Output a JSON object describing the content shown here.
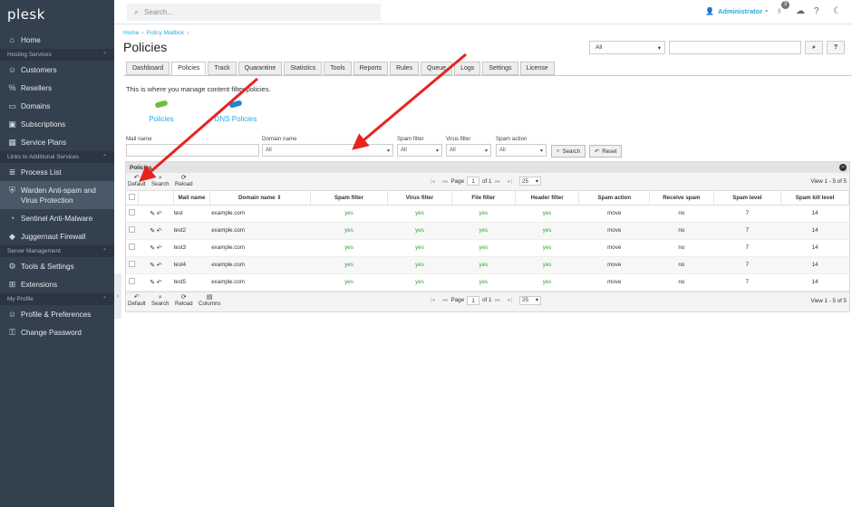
{
  "sidebar": {
    "logo": "plesk",
    "items": [
      {
        "type": "item",
        "label": "Home",
        "icon": "home-icon"
      },
      {
        "type": "section",
        "label": "Hosting Services"
      },
      {
        "type": "item",
        "label": "Customers",
        "icon": "user-icon"
      },
      {
        "type": "item",
        "label": "Resellers",
        "icon": "percent-icon"
      },
      {
        "type": "item",
        "label": "Domains",
        "icon": "domains-icon"
      },
      {
        "type": "item",
        "label": "Subscriptions",
        "icon": "subscriptions-icon"
      },
      {
        "type": "item",
        "label": "Service Plans",
        "icon": "plans-icon"
      },
      {
        "type": "section",
        "label": "Links to Additional Services"
      },
      {
        "type": "item",
        "label": "Process List",
        "icon": "list-icon"
      },
      {
        "type": "item",
        "label": "Warden Anti-spam and Virus Protection",
        "icon": "shield-icon",
        "active": true
      },
      {
        "type": "item",
        "label": "Sentinel Anti-Malware",
        "icon": "sentinel-icon"
      },
      {
        "type": "item",
        "label": "Juggernaut Firewall",
        "icon": "firewall-icon"
      },
      {
        "type": "section",
        "label": "Server Management"
      },
      {
        "type": "item",
        "label": "Tools & Settings",
        "icon": "tools-icon"
      },
      {
        "type": "item",
        "label": "Extensions",
        "icon": "extensions-icon"
      },
      {
        "type": "section",
        "label": "My Profile"
      },
      {
        "type": "item",
        "label": "Profile & Preferences",
        "icon": "profile-icon"
      },
      {
        "type": "item",
        "label": "Change Password",
        "icon": "key-icon"
      }
    ]
  },
  "topbar": {
    "search_placeholder": "Search...",
    "user": "Administrator",
    "notifications_count": "3"
  },
  "breadcrumb": {
    "home": "Home",
    "current": "Policy Mailbox"
  },
  "page_title": "Policies",
  "header_select": "All",
  "tabs": [
    "Dashboard",
    "Policies",
    "Track",
    "Quarantine",
    "Statistics",
    "Tools",
    "Reports",
    "Rules",
    "Queue",
    "Logs",
    "Settings",
    "License"
  ],
  "active_tab": "Policies",
  "description": "This is where you manage content filter policies.",
  "links": {
    "policies": "Policies",
    "dns_policies": "DNS Policies"
  },
  "filters": {
    "mail_name_label": "Mail name",
    "domain_name_label": "Domain name",
    "domain_name_value": "All",
    "spam_filter_label": "Spam filter",
    "spam_filter_value": "All",
    "virus_filter_label": "Virus filter",
    "virus_filter_value": "All",
    "spam_action_label": "Spam action",
    "spam_action_value": "All",
    "search_button": "Search",
    "reset_button": "Reset"
  },
  "grid": {
    "title": "Policies",
    "toolbar": {
      "default": "Default",
      "search": "Search",
      "reload": "Reload",
      "columns": "Columns"
    },
    "pager": {
      "page_label": "Page",
      "page": "1",
      "of_label": "of 1",
      "page_size": "25"
    },
    "view_info": "View 1 - 5 of 5",
    "columns": [
      "Mail name",
      "Domain name",
      "Spam filter",
      "Virus filter",
      "File filter",
      "Header filter",
      "Spam action",
      "Receive spam",
      "Spam level",
      "Spam kill level"
    ],
    "rows": [
      {
        "mail": "test",
        "domain": "example.com",
        "spam": "yes",
        "virus": "yes",
        "file": "yes",
        "header": "yes",
        "action": "move",
        "receive": "no",
        "level": "7",
        "kill": "14"
      },
      {
        "mail": "test2",
        "domain": "example.com",
        "spam": "yes",
        "virus": "yes",
        "file": "yes",
        "header": "yes",
        "action": "move",
        "receive": "no",
        "level": "7",
        "kill": "14"
      },
      {
        "mail": "test3",
        "domain": "example.com",
        "spam": "yes",
        "virus": "yes",
        "file": "yes",
        "header": "yes",
        "action": "move",
        "receive": "no",
        "level": "7",
        "kill": "14"
      },
      {
        "mail": "test4",
        "domain": "example.com",
        "spam": "yes",
        "virus": "yes",
        "file": "yes",
        "header": "yes",
        "action": "move",
        "receive": "no",
        "level": "7",
        "kill": "14"
      },
      {
        "mail": "test5",
        "domain": "example.com",
        "spam": "yes",
        "virus": "yes",
        "file": "yes",
        "header": "yes",
        "action": "move",
        "receive": "no",
        "level": "7",
        "kill": "14"
      }
    ]
  },
  "colors": {
    "sidebar": "#33404d",
    "link": "#28aade",
    "green": "#3a9b3a",
    "arrow": "#e8231f"
  }
}
